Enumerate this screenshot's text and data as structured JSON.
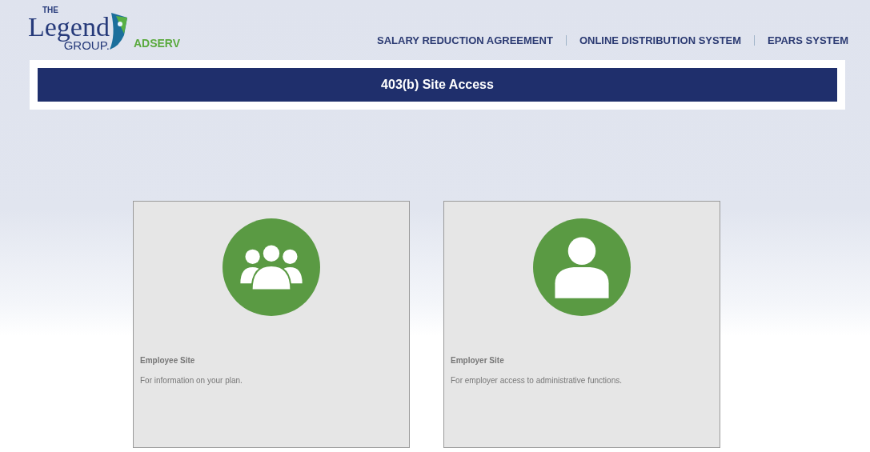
{
  "logo": {
    "the": "THE",
    "name": "Legend",
    "group": "GROUP.",
    "product": "ADSERV"
  },
  "nav": [
    {
      "label": "SALARY REDUCTION AGREEMENT"
    },
    {
      "label": "ONLINE DISTRIBUTION SYSTEM"
    },
    {
      "label": "EPARS SYSTEM"
    }
  ],
  "banner": {
    "title": "403(b) Site Access"
  },
  "cards": [
    {
      "kind": "group",
      "title": "Employee Site",
      "description": "For information on your plan."
    },
    {
      "kind": "person",
      "title": "Employer Site",
      "description": "For employer access to administrative functions."
    }
  ]
}
